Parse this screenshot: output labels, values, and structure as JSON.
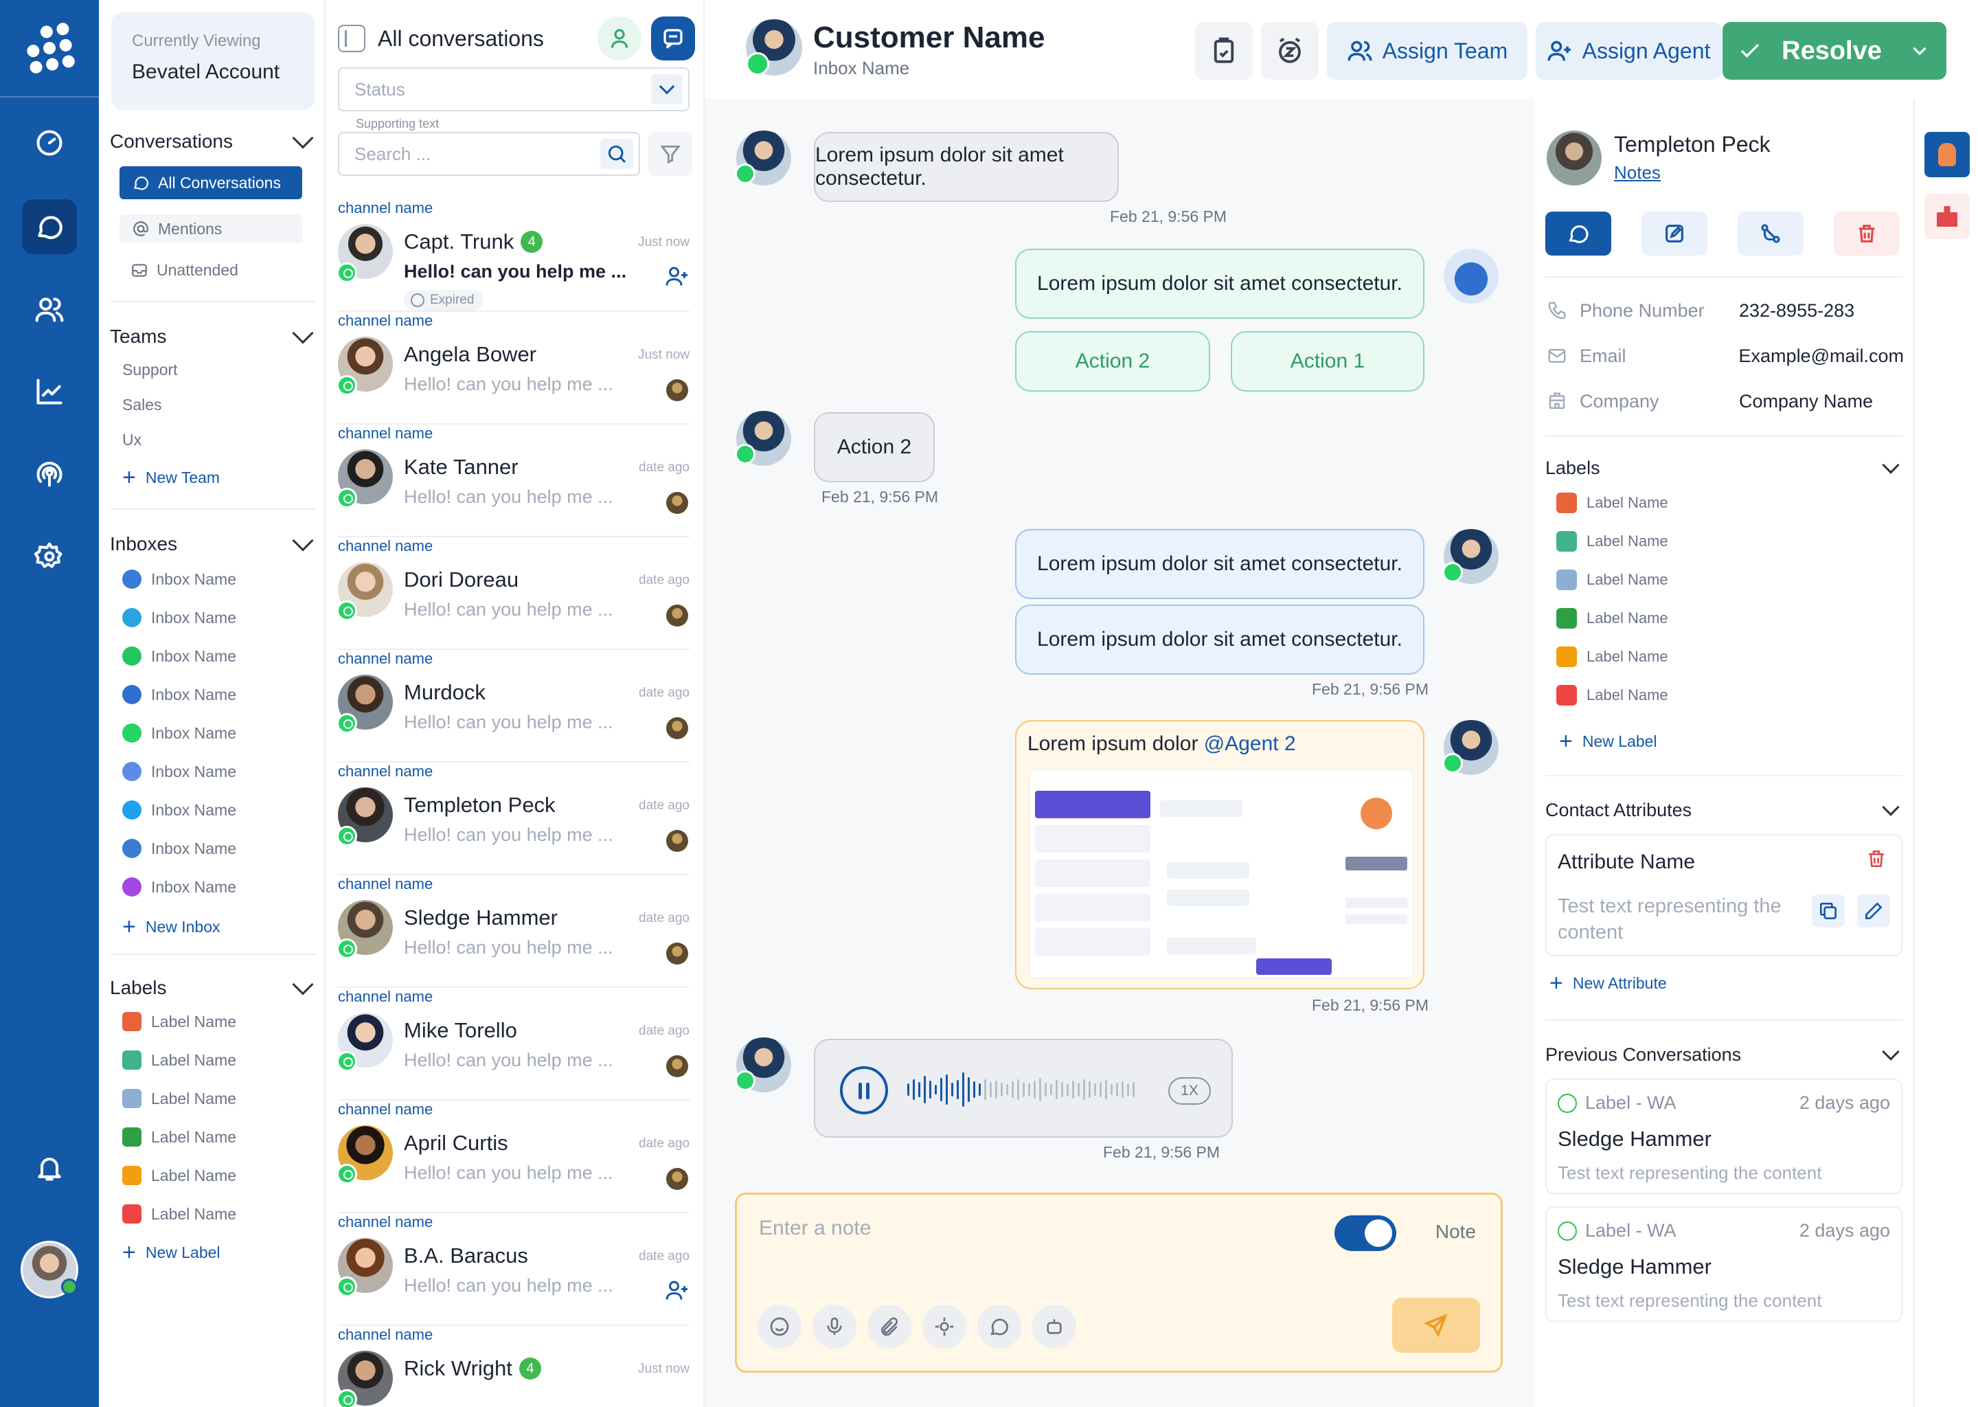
{
  "sidebar": {
    "viewing_label": "Currently Viewing",
    "account": "Bevatel Account",
    "conversations": {
      "title": "Conversations",
      "all": "All Conversations",
      "mentions": "Mentions",
      "unattended": "Unattended"
    },
    "teams": {
      "title": "Teams",
      "items": [
        "Support",
        "Sales",
        "Ux"
      ],
      "add": "New Team"
    },
    "inboxes": {
      "title": "Inboxes",
      "items": [
        {
          "label": "Inbox Name",
          "icon": "globe-icon",
          "color": "#3a7bd5"
        },
        {
          "label": "Inbox Name",
          "icon": "telegram-icon",
          "color": "#2aa3e0"
        },
        {
          "label": "Inbox Name",
          "icon": "line-icon",
          "color": "#22c55e"
        },
        {
          "label": "Inbox Name",
          "icon": "sms-icon",
          "color": "#2f6fd0"
        },
        {
          "label": "Inbox Name",
          "icon": "whatsapp-icon",
          "color": "#25d366"
        },
        {
          "label": "Inbox Name",
          "icon": "api-icon",
          "color": "#5b8de8"
        },
        {
          "label": "Inbox Name",
          "icon": "twitter-icon",
          "color": "#1da1f2"
        },
        {
          "label": "Inbox Name",
          "icon": "email-icon",
          "color": "#3a7bd5"
        },
        {
          "label": "Inbox Name",
          "icon": "messenger-icon",
          "color": "#a347e6"
        }
      ],
      "add": "New Inbox"
    },
    "labels": {
      "title": "Labels",
      "items": [
        {
          "label": "Label Name",
          "color": "#e8623a"
        },
        {
          "label": "Label Name",
          "color": "#3fb389"
        },
        {
          "label": "Label Name",
          "color": "#8eaed6"
        },
        {
          "label": "Label Name",
          "color": "#2ea043"
        },
        {
          "label": "Label Name",
          "color": "#f59e0b"
        },
        {
          "label": "Label Name",
          "color": "#ef4444"
        }
      ],
      "add": "New Label"
    }
  },
  "conv_list": {
    "title": "All conversations",
    "status_placeholder": "Status",
    "supporting_text": "Supporting text",
    "search_placeholder": "Search ...",
    "items": [
      {
        "channel": "channel name",
        "name": "Capt. Trunk",
        "count": "4",
        "msg": "Hello! can you help me ...",
        "time": "Just now",
        "unread": true,
        "expired": "Expired",
        "action": "assign",
        "face": "face1"
      },
      {
        "channel": "channel name",
        "name": "Angela Bower",
        "count": "",
        "msg": "Hello! can you help me ...",
        "time": "Just now",
        "unread": false,
        "action": "agent",
        "face": "face2"
      },
      {
        "channel": "channel name",
        "name": "Kate Tanner",
        "count": "",
        "msg": "Hello! can you help me ...",
        "time": "date ago",
        "unread": false,
        "action": "agent",
        "face": "face3"
      },
      {
        "channel": "channel name",
        "name": "Dori Doreau",
        "count": "",
        "msg": "Hello! can you help me ...",
        "time": "date ago",
        "unread": false,
        "action": "agent",
        "face": "face4"
      },
      {
        "channel": "channel name",
        "name": "Murdock",
        "count": "",
        "msg": "Hello! can you help me ...",
        "time": "date ago",
        "unread": false,
        "action": "agent",
        "face": "face5"
      },
      {
        "channel": "channel name",
        "name": "Templeton Peck",
        "count": "",
        "msg": "Hello! can you help me ...",
        "time": "date ago",
        "unread": false,
        "action": "agent",
        "face": "face6"
      },
      {
        "channel": "channel name",
        "name": "Sledge Hammer",
        "count": "",
        "msg": "Hello! can you help me ...",
        "time": "date ago",
        "unread": false,
        "action": "agent",
        "face": "face7"
      },
      {
        "channel": "channel name",
        "name": "Mike Torello",
        "count": "",
        "msg": "Hello! can you help me ...",
        "time": "date ago",
        "unread": false,
        "action": "agent",
        "face": "face8"
      },
      {
        "channel": "channel name",
        "name": "April Curtis",
        "count": "",
        "msg": "Hello! can you help me ...",
        "time": "date ago",
        "unread": false,
        "action": "agent",
        "face": "face9"
      },
      {
        "channel": "channel name",
        "name": "B.A. Baracus",
        "count": "",
        "msg": "Hello! can you help me ...",
        "time": "date ago",
        "unread": false,
        "action": "assign",
        "face": "face10"
      },
      {
        "channel": "channel name",
        "name": "Rick Wright",
        "count": "4",
        "msg": "",
        "time": "Just now",
        "unread": false,
        "action": "none",
        "face": "face11"
      }
    ]
  },
  "header": {
    "customer_name": "Customer Name",
    "inbox_name": "Inbox Name",
    "assign_team": "Assign Team",
    "assign_agent": "Assign Agent",
    "resolve": "Resolve"
  },
  "chat": {
    "msg1": "Lorem ipsum dolor sit amet consectetur.",
    "ts1": "Feb 21, 9:56 PM",
    "msg2": "Lorem ipsum dolor sit amet consectetur.",
    "action2": "Action 2",
    "action1": "Action 1",
    "msg3": "Action 2",
    "ts3": "Feb 21, 9:56 PM",
    "msg4": "Lorem ipsum dolor sit amet consectetur.",
    "msg5": "Lorem ipsum dolor sit amet consectetur.",
    "ts5": "Feb 21, 9:56 PM",
    "attach_caption": "Lorem ipsum dolor",
    "attach_mention": "@Agent 2",
    "ts6": "Feb 21, 9:56 PM",
    "voice_speed": "1X",
    "ts7": "Feb 21, 9:56 PM",
    "composer_placeholder": "Enter a note",
    "note_label": "Note"
  },
  "contact": {
    "name": "Templeton Peck",
    "notes": "Notes",
    "phone_key": "Phone Number",
    "phone": "232-8955-283",
    "email_key": "Email",
    "email": "Example@mail.com",
    "company_key": "Company",
    "company": "Company Name",
    "labels_title": "Labels",
    "labels": [
      {
        "label": "Label Name",
        "color": "#e8623a"
      },
      {
        "label": "Label Name",
        "color": "#3fb389"
      },
      {
        "label": "Label Name",
        "color": "#8eaed6"
      },
      {
        "label": "Label Name",
        "color": "#2ea043"
      },
      {
        "label": "Label Name",
        "color": "#f59e0b"
      },
      {
        "label": "Label Name",
        "color": "#ef4444"
      }
    ],
    "new_label": "New Label",
    "attrs_title": "Contact Attributes",
    "attr_name": "Attribute Name",
    "attr_value": "Test text representing the content",
    "new_attr": "New Attribute",
    "prev_title": "Previous Conversations",
    "prev": [
      {
        "label": "Label  -  WA",
        "ago": "2 days ago",
        "name": "Sledge Hammer",
        "text": "Test text representing the content"
      },
      {
        "label": "Label  -  WA",
        "ago": "2 days ago",
        "name": "Sledge Hammer",
        "text": "Test text representing the content"
      }
    ]
  }
}
